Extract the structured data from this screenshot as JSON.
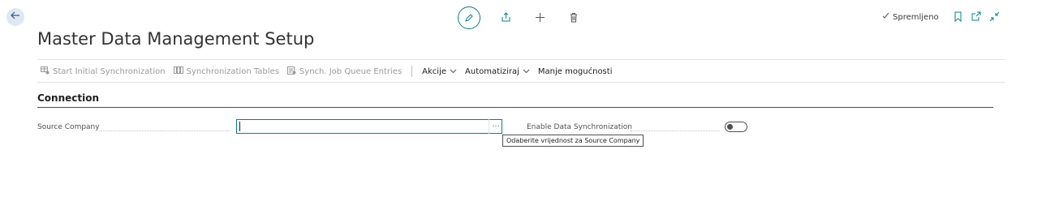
{
  "header": {
    "back_icon": "arrow-left-icon",
    "saved_label": "Spremljeno",
    "actions": [
      "edit-icon",
      "share-icon",
      "plus-icon",
      "trash-icon"
    ],
    "right_icons": [
      "bookmark-icon",
      "open-new-window-icon",
      "collapse-icon"
    ]
  },
  "page": {
    "title": "Master Data Management Setup"
  },
  "toolbar": {
    "start_sync": "Start Initial Synchronization",
    "sync_tables": "Synchronization Tables",
    "job_queue": "Synch. Job Queue Entries",
    "akcije": "Akcije",
    "automatiziraj": "Automatiziraj",
    "fewer": "Manje mogućnosti"
  },
  "connection": {
    "title": "Connection",
    "source_company_label": "Source Company",
    "source_company_value": "",
    "lookup_label": "···",
    "tooltip": "Odaberite vrijednost za Source Company",
    "enable_sync_label": "Enable Data Synchronization",
    "enable_sync_value": false
  },
  "colors": {
    "accent": "#00838f",
    "text": "#212121",
    "muted": "#9a9a9a"
  }
}
